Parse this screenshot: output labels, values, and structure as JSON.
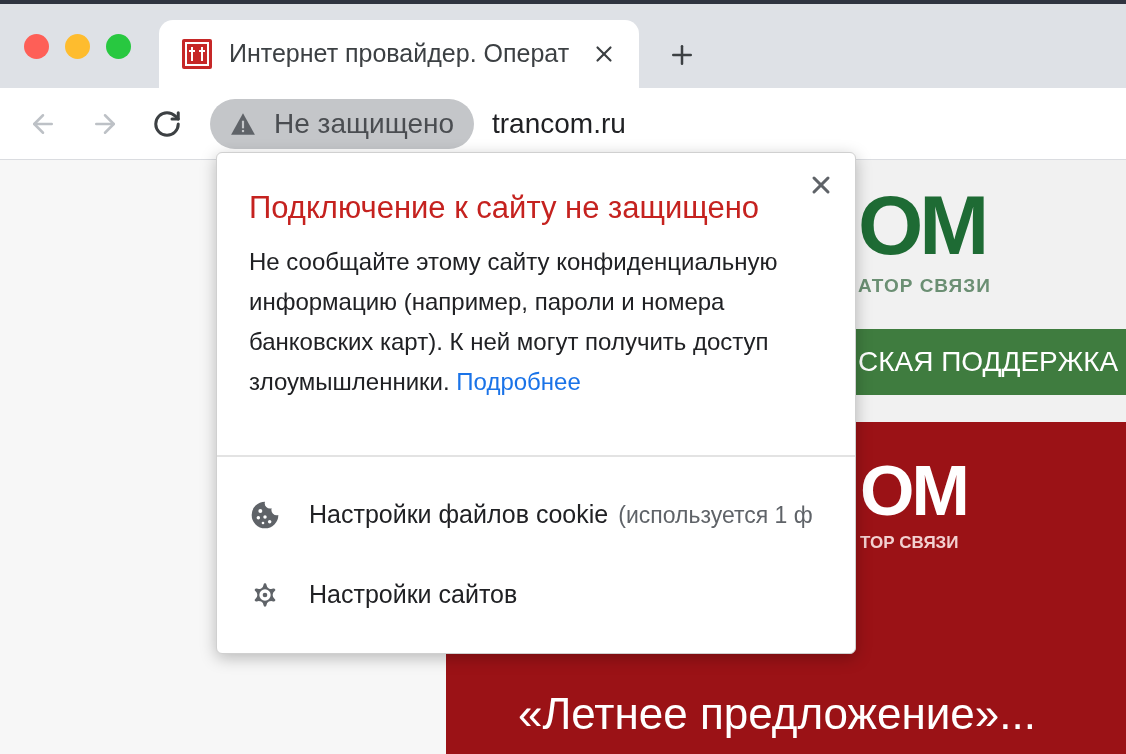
{
  "tabs": [
    {
      "title": "Интернет провайдер. Операт",
      "selected": true
    }
  ],
  "toolbar": {
    "back": {
      "disabled": true
    },
    "forward": {
      "disabled": true
    },
    "security_chip": "Не защищено",
    "url": "trancom.ru"
  },
  "page": {
    "logo_text": "OM",
    "tagline": "АТОР СВЯЗИ",
    "support_bar": "СКАЯ ПОДДЕРЖКА",
    "banner": {
      "logo_text": "OM",
      "tagline": "ТОР СВЯЗИ",
      "subheading": "«Летнее предложение»..."
    }
  },
  "popup": {
    "title": "Подключение к сайту не защищено",
    "body": "Не сообщайте этому сайту конфиденциальную информацию (например, пароли и номера банковских карт). К ней могут получить доступ злоумышленники.",
    "link": "Подробнее",
    "items": [
      {
        "kind": "cookie",
        "label": "Настройки файлов cookie",
        "detail": "(используется 1 ф"
      },
      {
        "kind": "settings",
        "label": "Настройки сайтов"
      }
    ]
  }
}
